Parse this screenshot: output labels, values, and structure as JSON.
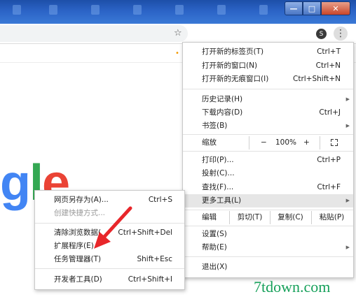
{
  "window": {
    "min_label": "—",
    "max_label": "□",
    "close_label": "✕"
  },
  "toolbar": {
    "star_glyph": "☆",
    "profile_initial": "S",
    "menu_glyph": "⋮"
  },
  "logo_text": {
    "g": "g",
    "l": "l",
    "e": "e"
  },
  "main_menu": {
    "new_tab": {
      "label": "打开新的标签页(T)",
      "shortcut": "Ctrl+T"
    },
    "new_window": {
      "label": "打开新的窗口(N)",
      "shortcut": "Ctrl+N"
    },
    "new_incognito": {
      "label": "打开新的无痕窗口(I)",
      "shortcut": "Ctrl+Shift+N"
    },
    "history": {
      "label": "历史记录(H)"
    },
    "downloads": {
      "label": "下载内容(D)",
      "shortcut": "Ctrl+J"
    },
    "bookmarks": {
      "label": "书签(B)"
    },
    "zoom": {
      "label": "缩放",
      "minus": "−",
      "value": "100%",
      "plus": "+"
    },
    "print": {
      "label": "打印(P)...",
      "shortcut": "Ctrl+P"
    },
    "cast": {
      "label": "投射(C)..."
    },
    "find": {
      "label": "查找(F)...",
      "shortcut": "Ctrl+F"
    },
    "more_tools": {
      "label": "更多工具(L)"
    },
    "edit": {
      "label": "编辑",
      "cut": "剪切(T)",
      "copy": "复制(C)",
      "paste": "粘贴(P)"
    },
    "settings": {
      "label": "设置(S)"
    },
    "help": {
      "label": "帮助(E)"
    },
    "exit": {
      "label": "退出(X)"
    }
  },
  "sub_menu": {
    "save_page": {
      "label": "网页另存为(A)...",
      "shortcut": "Ctrl+S"
    },
    "create_shortcut": {
      "label": "创建快捷方式..."
    },
    "clear_data": {
      "label": "清除浏览数据(",
      "shortcut": "Ctrl+Shift+Del"
    },
    "extensions": {
      "label": "扩展程序(E)"
    },
    "task_manager": {
      "label": "任务管理器(T)",
      "shortcut": "Shift+Esc"
    },
    "dev_tools": {
      "label": "开发者工具(D)",
      "shortcut": "Ctrl+Shift+I"
    }
  },
  "watermark": "7tdown.com",
  "colors": {
    "annotation_arrow": "#e8262a",
    "highlight": "#e6e6e6",
    "watermark": "#16a05a"
  }
}
